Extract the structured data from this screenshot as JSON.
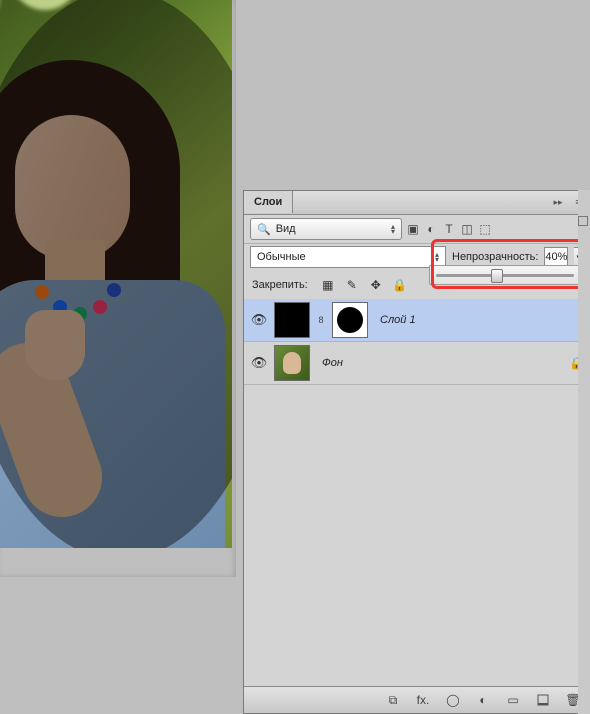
{
  "panel": {
    "title": "Слои",
    "filter_label": "Вид",
    "blend_mode": "Обычные",
    "opacity_label": "Непрозрачность:",
    "opacity_value": "40%",
    "lock_label": "Закрепить:"
  },
  "layers": [
    {
      "name": "Слой 1",
      "visible": true,
      "selected": true,
      "has_mask": true,
      "locked": false
    },
    {
      "name": "Фон",
      "visible": true,
      "selected": false,
      "has_mask": false,
      "locked": true
    }
  ],
  "icons": {
    "eye": "👁",
    "lock": "🔒",
    "chain": "⛓",
    "menu_collapse": "▸▸",
    "menu_lines": "≡",
    "search": "🔍",
    "img": "▣",
    "adjust": "◐",
    "text": "T",
    "crop": "◫",
    "smart": "⬚",
    "checker": "▦",
    "brush": "✎",
    "move": "✥",
    "fx": "fx.",
    "mask": "◯",
    "folder": "▭",
    "adjustlayer": "◐",
    "newlayer": "▫",
    "trash": "🗑",
    "link": "⧉",
    "triangle": "▾"
  }
}
